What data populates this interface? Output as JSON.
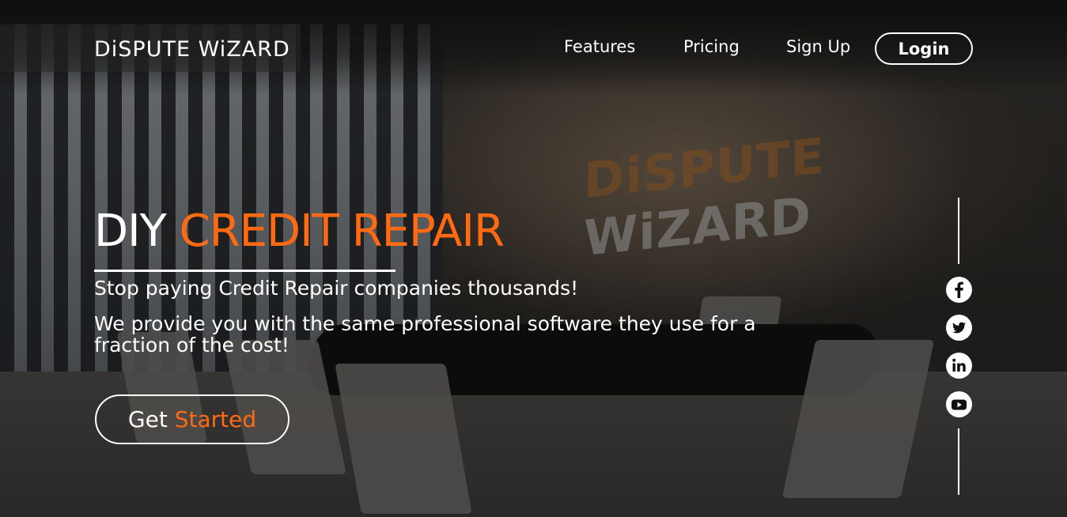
{
  "header": {
    "logo_text": "DiSPUTE WiZARD",
    "nav": {
      "features": "Features",
      "pricing": "Pricing",
      "signup": "Sign Up",
      "login": "Login"
    }
  },
  "background": {
    "wall_logo_part1": "DiSPUTE",
    "wall_logo_part2": "WiZARD"
  },
  "hero": {
    "title_prefix": "DIY",
    "title_accent": "CREDIT REPAIR",
    "subtitle": "Stop paying Credit Repair companies thousands!",
    "description": "We provide you with the same professional software they use for a fraction of the cost!",
    "cta_prefix": "Get",
    "cta_accent": "Started"
  },
  "social": {
    "icons": [
      "facebook-icon",
      "twitter-icon",
      "linkedin-icon",
      "youtube-icon"
    ]
  },
  "colors": {
    "accent": "#ff6a13",
    "text": "#ffffff"
  }
}
